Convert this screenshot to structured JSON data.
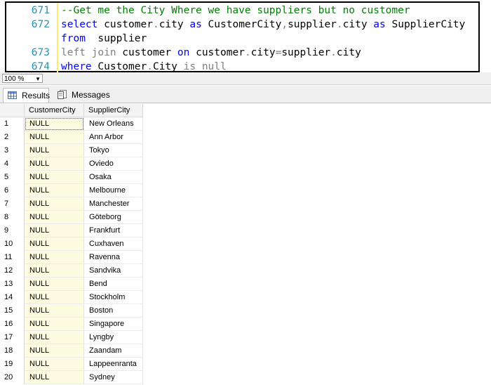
{
  "editor": {
    "lines": [
      {
        "num": "671",
        "tokens": [
          {
            "t": "--Get me the City Where we have suppliers but no customer",
            "c": "cmt"
          }
        ]
      },
      {
        "num": "672",
        "tokens": [
          {
            "t": "select",
            "c": "kw"
          },
          {
            "t": " customer",
            "c": "id"
          },
          {
            "t": ".",
            "c": "gray"
          },
          {
            "t": "city ",
            "c": "id"
          },
          {
            "t": "as",
            "c": "kw"
          },
          {
            "t": " CustomerCity",
            "c": "id"
          },
          {
            "t": ",",
            "c": "gray"
          },
          {
            "t": "supplier",
            "c": "id"
          },
          {
            "t": ".",
            "c": "gray"
          },
          {
            "t": "city ",
            "c": "id"
          },
          {
            "t": "as",
            "c": "kw"
          },
          {
            "t": " SupplierCity",
            "c": "id"
          }
        ]
      },
      {
        "num": "",
        "tokens": [
          {
            "t": "from",
            "c": "kw"
          },
          {
            "t": "  supplier",
            "c": "id"
          }
        ]
      },
      {
        "num": "673",
        "tokens": [
          {
            "t": "left join",
            "c": "gray"
          },
          {
            "t": " customer ",
            "c": "id"
          },
          {
            "t": "on",
            "c": "kw"
          },
          {
            "t": " customer",
            "c": "id"
          },
          {
            "t": ".",
            "c": "gray"
          },
          {
            "t": "city",
            "c": "id"
          },
          {
            "t": "=",
            "c": "gray"
          },
          {
            "t": "supplier",
            "c": "id"
          },
          {
            "t": ".",
            "c": "gray"
          },
          {
            "t": "city",
            "c": "id"
          }
        ]
      },
      {
        "num": "674",
        "tokens": [
          {
            "t": "where",
            "c": "kw"
          },
          {
            "t": " Customer",
            "c": "id"
          },
          {
            "t": ".",
            "c": "gray"
          },
          {
            "t": "City ",
            "c": "id"
          },
          {
            "t": "is null",
            "c": "gray"
          }
        ]
      }
    ]
  },
  "zoom": {
    "value": "100 %"
  },
  "tabs": [
    {
      "label": "Results",
      "icon": "grid-icon"
    },
    {
      "label": "Messages",
      "icon": "messages-icon"
    }
  ],
  "grid": {
    "columns": [
      "CustomerCity",
      "SupplierCity"
    ],
    "rows": [
      [
        "1",
        "NULL",
        "New Orleans"
      ],
      [
        "2",
        "NULL",
        "Ann Arbor"
      ],
      [
        "3",
        "NULL",
        "Tokyo"
      ],
      [
        "4",
        "NULL",
        "Oviedo"
      ],
      [
        "5",
        "NULL",
        "Osaka"
      ],
      [
        "6",
        "NULL",
        "Melbourne"
      ],
      [
        "7",
        "NULL",
        "Manchester"
      ],
      [
        "8",
        "NULL",
        "Göteborg"
      ],
      [
        "9",
        "NULL",
        "Frankfurt"
      ],
      [
        "10",
        "NULL",
        "Cuxhaven"
      ],
      [
        "11",
        "NULL",
        "Ravenna"
      ],
      [
        "12",
        "NULL",
        "Sandvika"
      ],
      [
        "13",
        "NULL",
        "Bend"
      ],
      [
        "14",
        "NULL",
        "Stockholm"
      ],
      [
        "15",
        "NULL",
        "Boston"
      ],
      [
        "16",
        "NULL",
        "Singapore"
      ],
      [
        "17",
        "NULL",
        "Lyngby"
      ],
      [
        "18",
        "NULL",
        "Zaandam"
      ],
      [
        "19",
        "NULL",
        "Lappeenranta"
      ],
      [
        "20",
        "NULL",
        "Sydney"
      ]
    ]
  },
  "colors": {
    "keyword": "#0000ff",
    "comment": "#008000",
    "line_number": "#2b91af",
    "null_bg": "#fdfbe0"
  }
}
